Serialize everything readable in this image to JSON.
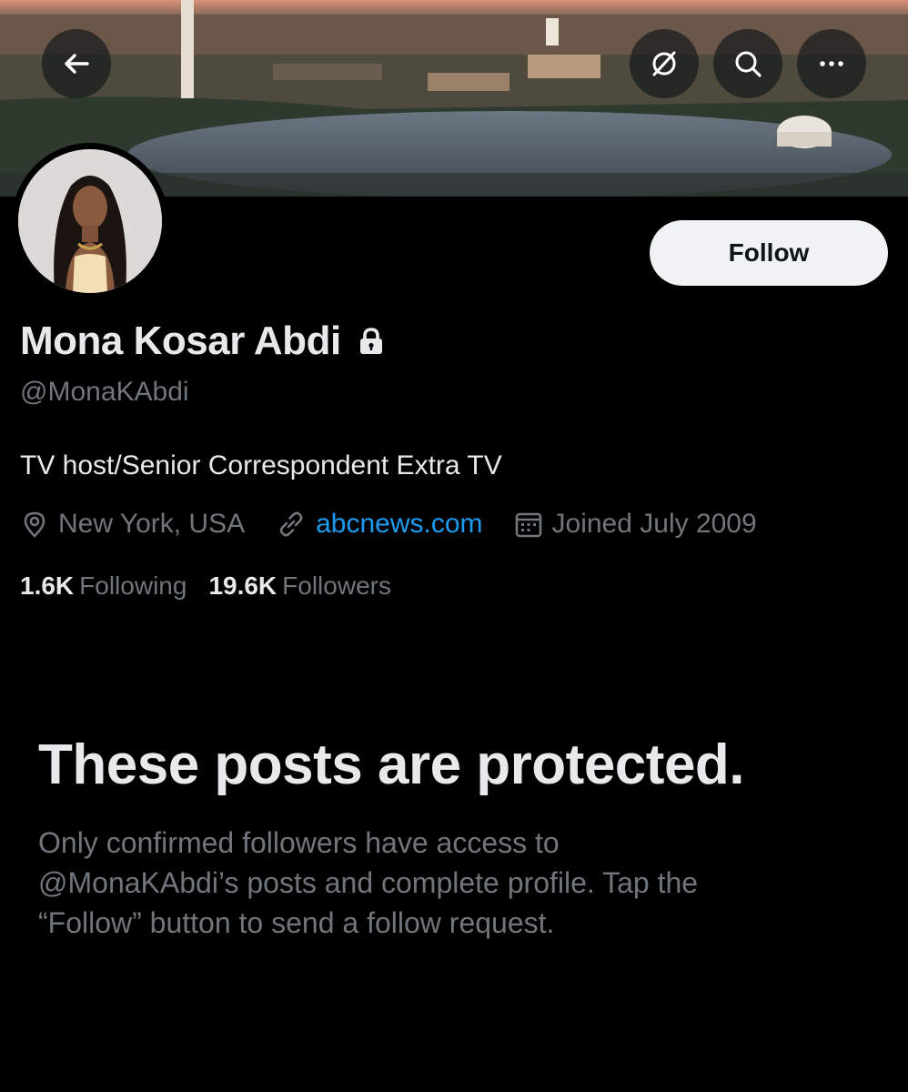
{
  "header": {
    "back_icon": "arrow-left-icon",
    "action_icons": [
      "notifications-off-icon",
      "search-icon",
      "more-icon"
    ]
  },
  "profile": {
    "name": "Mona Kosar Abdi",
    "handle": "@MonaKAbdi",
    "bio": "TV host/Senior Correspondent Extra TV",
    "location": "New York, USA",
    "website": "abcnews.com",
    "joined": "Joined July 2009",
    "following_count": "1.6K",
    "following_label": "Following",
    "followers_count": "19.6K",
    "followers_label": "Followers",
    "follow_button": "Follow"
  },
  "protected": {
    "title": "These posts are protected.",
    "body_line1": "Only confirmed followers have access to",
    "body_line2": "@MonaKAbdi’s posts and complete profile. Tap the",
    "body_line3": "“Follow” button to send a follow request."
  },
  "colors": {
    "background": "#000000",
    "primary_text": "#e7e9ea",
    "secondary_text": "#71767b",
    "link": "#1d9bf0",
    "follow_button_bg": "#eff3f4"
  }
}
